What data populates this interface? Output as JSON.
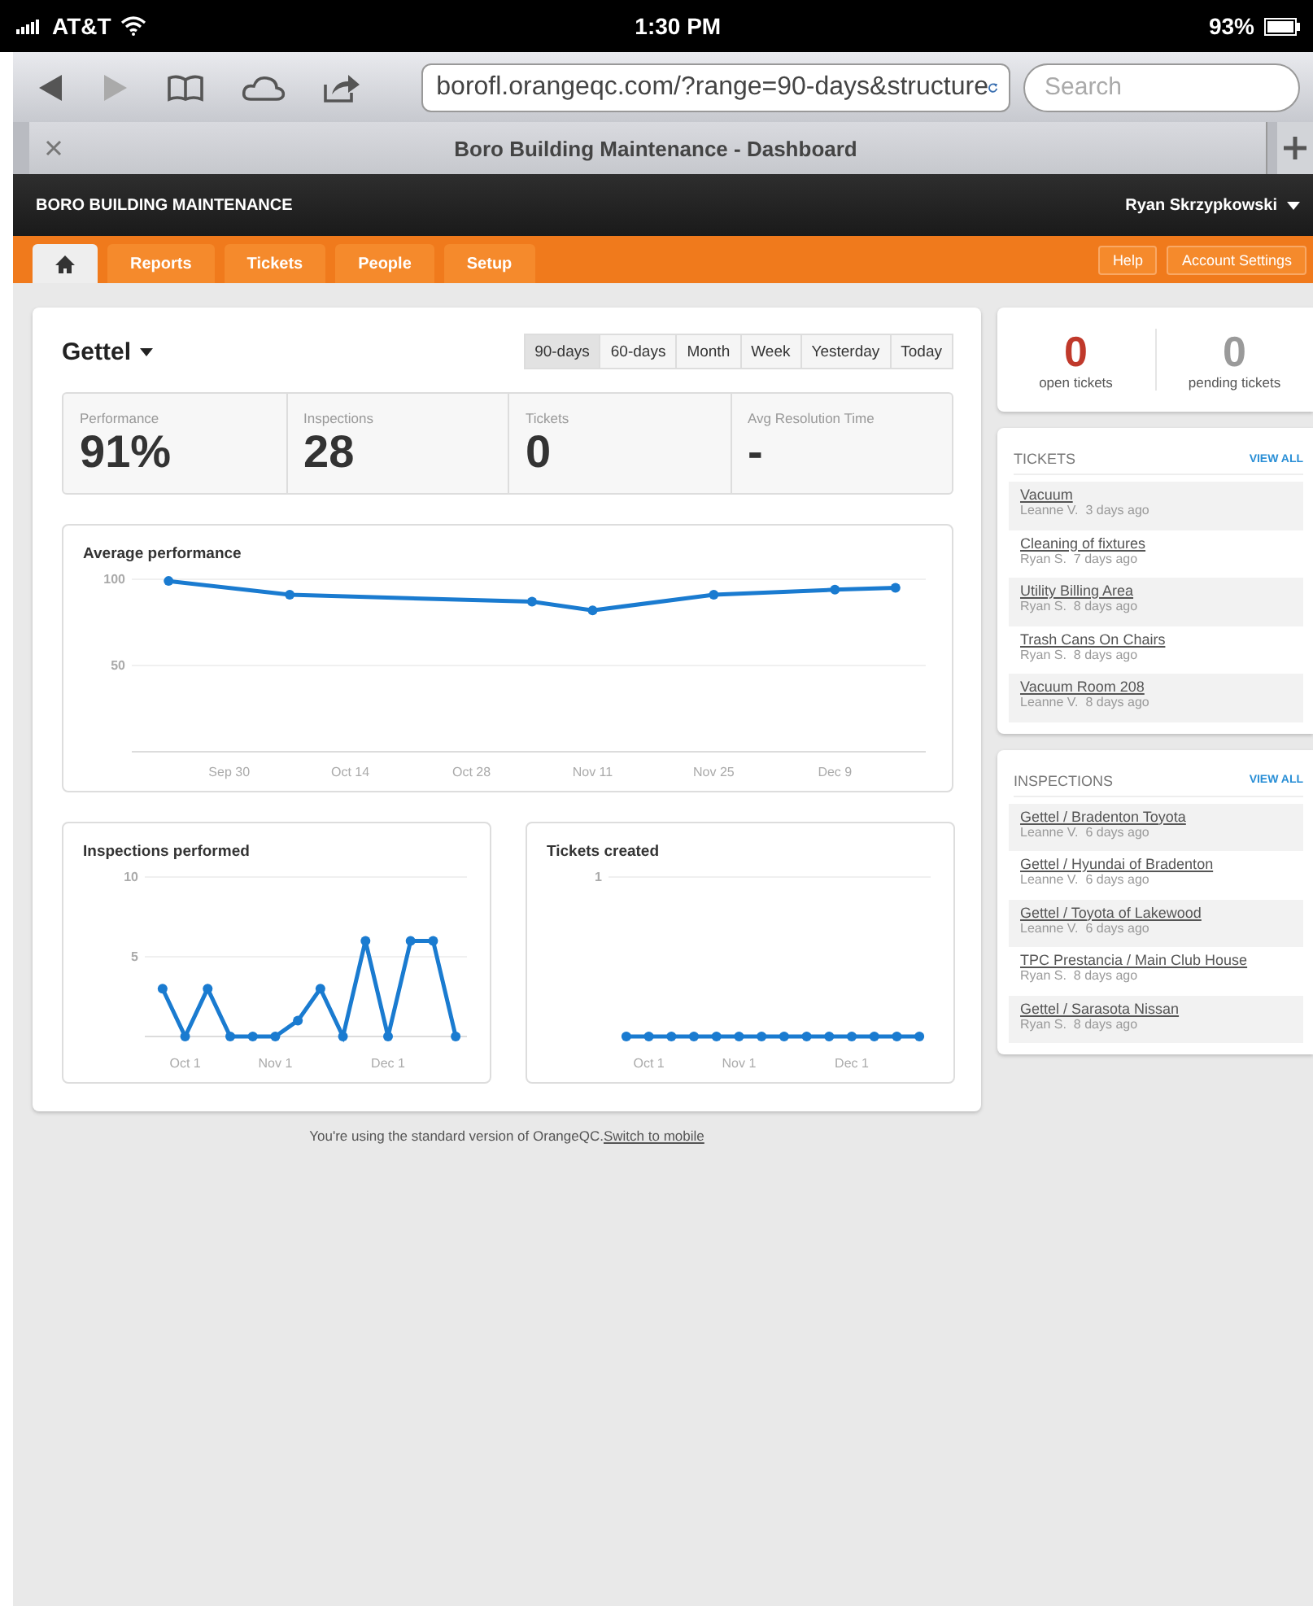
{
  "status_bar": {
    "carrier": "AT&T",
    "time": "1:30 PM",
    "battery": "93%"
  },
  "browser": {
    "url": "borofl.orangeqc.com/?range=90-days&structure",
    "search_placeholder": "Search",
    "tab_title": "Boro Building Maintenance - Dashboard"
  },
  "app_header": {
    "brand": "BORO BUILDING MAINTENANCE",
    "user": "Ryan Skrzypkowski"
  },
  "nav": {
    "tabs": [
      {
        "kind": "home",
        "selected": true
      },
      {
        "kind": "text",
        "label": "Reports",
        "selected": false
      },
      {
        "kind": "text",
        "label": "Tickets",
        "selected": false
      },
      {
        "kind": "text",
        "label": "People",
        "selected": false
      },
      {
        "kind": "text",
        "label": "Setup",
        "selected": false
      }
    ],
    "right_buttons": [
      "Help",
      "Account Settings"
    ]
  },
  "dashboard": {
    "location": "Gettel",
    "ranges": [
      {
        "label": "90-days",
        "selected": true
      },
      {
        "label": "60-days",
        "selected": false
      },
      {
        "label": "Month",
        "selected": false
      },
      {
        "label": "Week",
        "selected": false
      },
      {
        "label": "Yesterday",
        "selected": false
      },
      {
        "label": "Today",
        "selected": false
      }
    ],
    "stats": [
      {
        "label": "Performance",
        "value": "91%"
      },
      {
        "label": "Inspections",
        "value": "28"
      },
      {
        "label": "Tickets",
        "value": "0"
      },
      {
        "label": "Avg Resolution Time",
        "value": "-"
      }
    ],
    "performance_chart": {
      "chart_data": {
        "type": "line",
        "title": "Average performance",
        "categories": [
          null,
          "Sep 30",
          null,
          "Oct 14",
          null,
          "Oct 28",
          null,
          "Nov 11",
          null,
          "Nov 25",
          null,
          "Dec 9",
          null
        ],
        "series": [
          {
            "color": "#1a7bd0",
            "marker": "circle",
            "values": [
              99,
              null,
              91,
              null,
              null,
              null,
              87,
              82,
              null,
              91,
              null,
              94,
              95
            ]
          }
        ],
        "ylim": [
          0,
          100
        ],
        "yticks": [
          50,
          100
        ]
      }
    },
    "small_charts": [
      {
        "chart_data": {
          "type": "line",
          "title": "Inspections performed",
          "categories": [
            null,
            "Oct 1",
            null,
            null,
            null,
            "Nov 1",
            null,
            null,
            null,
            null,
            "Dec 1",
            null,
            null,
            null
          ],
          "series": [
            {
              "color": "#1a7bd0",
              "marker": "circle",
              "values": [
                3,
                0,
                3,
                0,
                0,
                0,
                1,
                3,
                0,
                6,
                0,
                6,
                6,
                0
              ]
            }
          ],
          "ylim": [
            0,
            10
          ],
          "yticks": [
            5,
            10
          ]
        }
      },
      {
        "kind": "picture",
        "title": "Tickets created",
        "y_label": "1",
        "x_labels": [
          "Oct 1",
          "Nov 1",
          "Dec 1"
        ]
      }
    ]
  },
  "summary": [
    {
      "value": "0",
      "label": "open tickets",
      "color": "#c0392b"
    },
    {
      "value": "0",
      "label": "pending tickets",
      "color": "#9a9a9a"
    }
  ],
  "lists": [
    {
      "title": "TICKETS",
      "view_all": "VIEW ALL",
      "items": [
        {
          "title": "Vacuum",
          "author": "Leanne V.",
          "ago": "3 days ago"
        },
        {
          "title": "Cleaning of fixtures",
          "author": "Ryan S.",
          "ago": "7 days ago"
        },
        {
          "title": "Utility Billing Area",
          "author": "Ryan S.",
          "ago": "8 days ago"
        },
        {
          "title": "Trash Cans On Chairs",
          "author": "Ryan S.",
          "ago": "8 days ago"
        },
        {
          "title": "Vacuum Room 208",
          "author": "Leanne V.",
          "ago": "8 days ago"
        }
      ]
    },
    {
      "title": "INSPECTIONS",
      "view_all": "VIEW ALL",
      "items": [
        {
          "title": "Gettel / Bradenton Toyota",
          "author": "Leanne V.",
          "ago": "6 days ago"
        },
        {
          "title": "Gettel / Hyundai of Bradenton",
          "author": "Leanne V.",
          "ago": "6 days ago"
        },
        {
          "title": "Gettel / Toyota of Lakewood",
          "author": "Leanne V.",
          "ago": "6 days ago"
        },
        {
          "title": "TPC Prestancia / Main Club House",
          "author": "Ryan S.",
          "ago": "8 days ago"
        },
        {
          "title": "Gettel / Sarasota Nissan",
          "author": "Ryan S.",
          "ago": "8 days ago"
        }
      ]
    }
  ],
  "footer": {
    "text": "You're using the standard version of OrangeQC.",
    "link": "Switch to mobile"
  }
}
